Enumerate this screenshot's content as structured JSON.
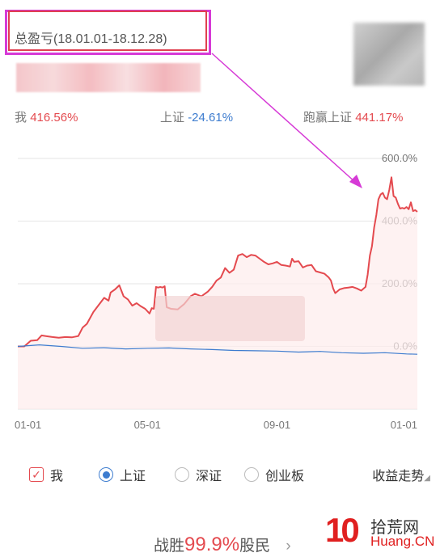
{
  "header": {
    "title": "总盈亏(18.01.01-18.12.28)"
  },
  "stats": {
    "me_label": "我",
    "me_value": "416.56%",
    "sh_label": "上证",
    "sh_value": "-24.61%",
    "beat_label": "跑赢上证",
    "beat_value": "441.17%"
  },
  "colors": {
    "red": "#e44a4f",
    "blue": "#3d7ccf",
    "annotation": "#d63ad6"
  },
  "legend": {
    "me": "我",
    "sh": "上证",
    "sz": "深证",
    "cy": "创业板",
    "trend": "收益走势"
  },
  "bottom": {
    "prefix": "战胜",
    "value": "99.9%",
    "suffix": "股民",
    "arrow": "›"
  },
  "watermark": {
    "num": "10",
    "text1": "拾荒网",
    "text2": "Huang.CN"
  },
  "chart_data": {
    "type": "line",
    "x_ticks": [
      "01-01",
      "05-01",
      "09-01",
      "01-01"
    ],
    "y_ticks": [
      "0.0%",
      "200.0%",
      "400.0%",
      "600.0%"
    ],
    "ylim": [
      -200,
      600
    ],
    "series": [
      {
        "name": "我",
        "color": "#e44a4f",
        "points": [
          [
            0,
            0
          ],
          [
            3,
            0
          ],
          [
            6,
            18
          ],
          [
            9,
            20
          ],
          [
            11,
            35
          ],
          [
            13,
            33
          ],
          [
            16,
            30
          ],
          [
            19,
            28
          ],
          [
            22,
            30
          ],
          [
            25,
            29
          ],
          [
            28,
            33
          ],
          [
            30,
            60
          ],
          [
            32,
            72
          ],
          [
            35,
            110
          ],
          [
            37,
            128
          ],
          [
            40,
            155
          ],
          [
            42,
            146
          ],
          [
            43,
            172
          ],
          [
            45,
            182
          ],
          [
            47,
            195
          ],
          [
            49,
            160
          ],
          [
            51,
            150
          ],
          [
            53,
            130
          ],
          [
            55,
            138
          ],
          [
            57,
            128
          ],
          [
            59,
            120
          ],
          [
            61,
            105
          ],
          [
            62,
            122
          ],
          [
            63,
            120
          ],
          [
            64,
            190
          ],
          [
            65,
            188
          ],
          [
            66,
            190
          ],
          [
            67,
            188
          ],
          [
            68,
            192
          ],
          [
            69,
            125
          ],
          [
            71,
            120
          ],
          [
            74,
            118
          ],
          [
            77,
            135
          ],
          [
            80,
            160
          ],
          [
            82,
            168
          ],
          [
            85,
            160
          ],
          [
            88,
            175
          ],
          [
            90,
            190
          ],
          [
            92,
            210
          ],
          [
            94,
            220
          ],
          [
            96,
            250
          ],
          [
            98,
            235
          ],
          [
            100,
            245
          ],
          [
            102,
            290
          ],
          [
            104,
            295
          ],
          [
            106,
            285
          ],
          [
            108,
            292
          ],
          [
            110,
            290
          ],
          [
            112,
            280
          ],
          [
            114,
            270
          ],
          [
            116,
            262
          ],
          [
            118,
            265
          ],
          [
            120,
            270
          ],
          [
            122,
            260
          ],
          [
            124,
            258
          ],
          [
            126,
            255
          ],
          [
            127,
            280
          ],
          [
            128,
            270
          ],
          [
            130,
            272
          ],
          [
            132,
            252
          ],
          [
            134,
            258
          ],
          [
            136,
            260
          ],
          [
            138,
            240
          ],
          [
            140,
            236
          ],
          [
            142,
            232
          ],
          [
            144,
            220
          ],
          [
            145,
            210
          ],
          [
            146,
            185
          ],
          [
            147,
            170
          ],
          [
            149,
            182
          ],
          [
            151,
            186
          ],
          [
            153,
            188
          ],
          [
            155,
            190
          ],
          [
            157,
            185
          ],
          [
            159,
            178
          ],
          [
            161,
            190
          ],
          [
            162,
            230
          ],
          [
            163,
            290
          ],
          [
            164,
            320
          ],
          [
            165,
            380
          ],
          [
            166,
            420
          ],
          [
            167,
            470
          ],
          [
            168,
            485
          ],
          [
            169,
            490
          ],
          [
            170,
            475
          ],
          [
            171,
            470
          ],
          [
            172,
            500
          ],
          [
            173,
            540
          ],
          [
            174,
            480
          ],
          [
            175,
            475
          ],
          [
            176,
            455
          ],
          [
            177,
            440
          ],
          [
            178,
            442
          ],
          [
            179,
            440
          ],
          [
            180,
            445
          ],
          [
            181,
            438
          ],
          [
            182,
            460
          ],
          [
            183,
            432
          ],
          [
            184,
            435
          ],
          [
            185,
            430
          ]
        ]
      },
      {
        "name": "上证",
        "color": "#3d7ccf",
        "points": [
          [
            0,
            0
          ],
          [
            10,
            5
          ],
          [
            20,
            0
          ],
          [
            30,
            -6
          ],
          [
            40,
            -4
          ],
          [
            50,
            -8
          ],
          [
            60,
            -6
          ],
          [
            70,
            -5
          ],
          [
            80,
            -8
          ],
          [
            90,
            -10
          ],
          [
            100,
            -13
          ],
          [
            110,
            -14
          ],
          [
            120,
            -15
          ],
          [
            130,
            -18
          ],
          [
            140,
            -16
          ],
          [
            150,
            -20
          ],
          [
            160,
            -22
          ],
          [
            170,
            -20
          ],
          [
            180,
            -24
          ],
          [
            185,
            -25
          ]
        ]
      }
    ]
  }
}
